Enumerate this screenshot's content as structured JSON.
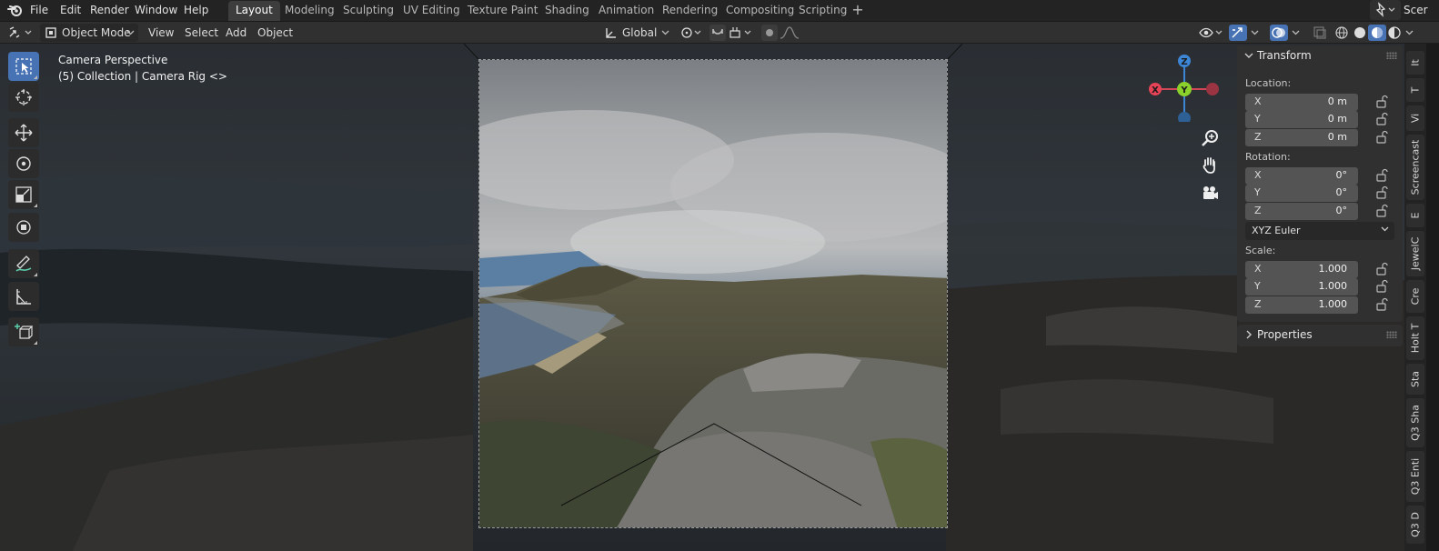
{
  "app": {
    "menu": [
      "File",
      "Edit",
      "Render",
      "Window",
      "Help"
    ],
    "workspaces": [
      "Layout",
      "Modeling",
      "Sculpting",
      "UV Editing",
      "Texture Paint",
      "Shading",
      "Animation",
      "Rendering",
      "Compositing",
      "Scripting"
    ],
    "active_workspace": "Layout",
    "add_workspace": "+",
    "scene_label": "Scer"
  },
  "header": {
    "mode": "Object Mode",
    "menus": [
      "View",
      "Select",
      "Add",
      "Object"
    ],
    "orientation": "Global"
  },
  "viewport": {
    "title": "Camera Perspective",
    "subtitle": "(5) Collection | Camera Rig <>"
  },
  "gizmo": {
    "z": "Z",
    "y": "Y",
    "x": "X"
  },
  "transform_panel": {
    "title": "Transform",
    "location_label": "Location:",
    "location": [
      {
        "axis": "X",
        "value": "0 m"
      },
      {
        "axis": "Y",
        "value": "0 m"
      },
      {
        "axis": "Z",
        "value": "0 m"
      }
    ],
    "rotation_label": "Rotation:",
    "rotation": [
      {
        "axis": "X",
        "value": "0°"
      },
      {
        "axis": "Y",
        "value": "0°"
      },
      {
        "axis": "Z",
        "value": "0°"
      }
    ],
    "rotation_mode": "XYZ Euler",
    "scale_label": "Scale:",
    "scale": [
      {
        "axis": "X",
        "value": "1.000"
      },
      {
        "axis": "Y",
        "value": "1.000"
      },
      {
        "axis": "Z",
        "value": "1.000"
      }
    ]
  },
  "properties_panel": {
    "title": "Properties"
  },
  "sidebar_tabs": [
    "It",
    "T",
    "Vi",
    "Screencast",
    "E",
    "JewelC",
    "Cre",
    "Holt T",
    "Sta",
    "Q3 Sha",
    "Q3 Enti",
    "Q3 D"
  ],
  "colors": {
    "accent": "#4772b3",
    "axis_x": "#e64356",
    "axis_y": "#8bd12c",
    "axis_z": "#3d86d6"
  }
}
